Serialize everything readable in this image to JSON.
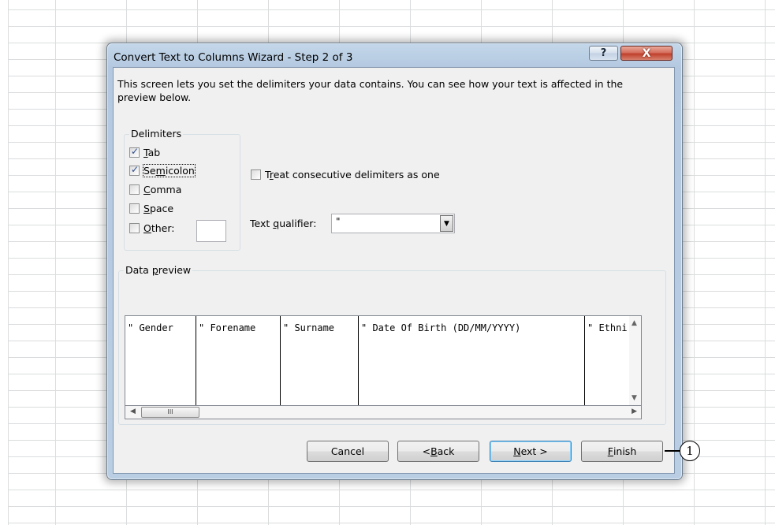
{
  "dialog": {
    "title": "Convert Text to Columns Wizard - Step 2 of 3",
    "help_label": "?",
    "close_label": "X",
    "description": "This screen lets you set the delimiters your data contains.  You can see how your text is affected in the preview below."
  },
  "delimiters": {
    "legend": "Delimiters",
    "items": [
      {
        "pre": "",
        "u": "T",
        "post": "ab",
        "checked": true
      },
      {
        "pre": "Se",
        "u": "m",
        "post": "icolon",
        "checked": true
      },
      {
        "pre": "",
        "u": "C",
        "post": "omma",
        "checked": false
      },
      {
        "pre": "",
        "u": "S",
        "post": "pace",
        "checked": false
      },
      {
        "pre": "",
        "u": "O",
        "post": "ther:",
        "checked": false
      }
    ],
    "other_value": ""
  },
  "options": {
    "consecutive": {
      "pre": "T",
      "u": "r",
      "post": "eat consecutive delimiters as one",
      "checked": false
    },
    "qualifier": {
      "pre": "Text ",
      "u": "q",
      "post": "ualifier:",
      "value": "\""
    }
  },
  "preview": {
    "legend_pre": "Data ",
    "legend_u": "p",
    "legend_post": "review",
    "columns": [
      "\" Gender",
      "\" Forename",
      "\" Surname",
      "\" Date Of Birth (DD/MM/YYYY)",
      "\" Ethni"
    ],
    "scroll_thumb": "III"
  },
  "buttons": {
    "cancel": {
      "pre": "Cancel",
      "u": "",
      "post": ""
    },
    "back": {
      "pre": "< ",
      "u": "B",
      "post": "ack"
    },
    "next": {
      "pre": "",
      "u": "N",
      "post": "ext >"
    },
    "finish": {
      "pre": "",
      "u": "F",
      "post": "inish"
    }
  },
  "callout": {
    "label": "1"
  }
}
